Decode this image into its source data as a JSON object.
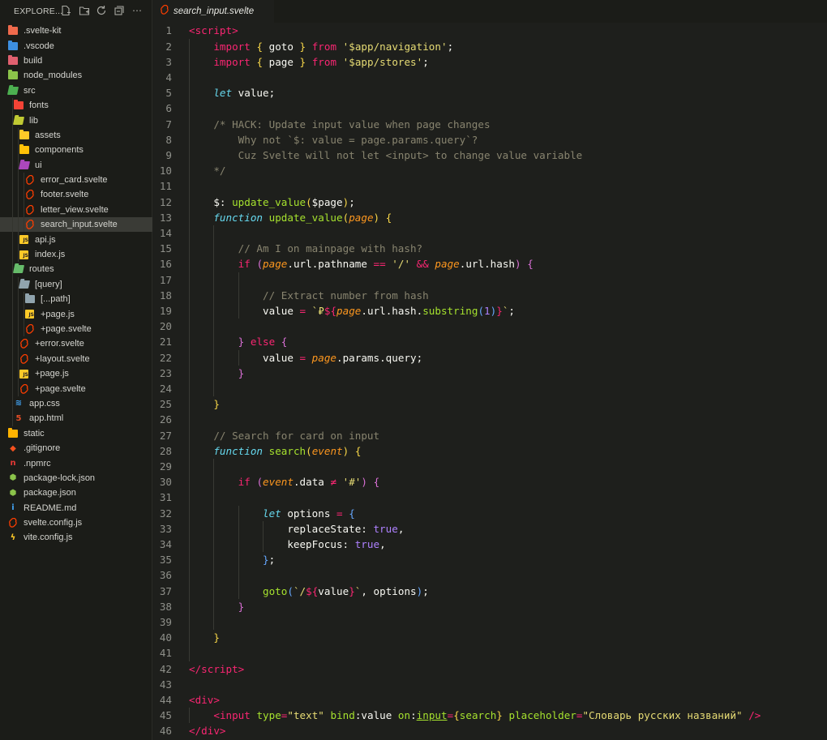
{
  "explorer": {
    "title": "EXPLORE...",
    "items": [
      {
        "label": ".svelte-kit",
        "depth": 0,
        "kind": "folder",
        "color": "#ef6a4c"
      },
      {
        "label": ".vscode",
        "depth": 0,
        "kind": "folder",
        "color": "#3d8fe0"
      },
      {
        "label": "build",
        "depth": 0,
        "kind": "folder",
        "color": "#e0606f"
      },
      {
        "label": "node_modules",
        "depth": 0,
        "kind": "folder",
        "color": "#8bc34a"
      },
      {
        "label": "src",
        "depth": 0,
        "kind": "folder-open",
        "color": "#4caf50"
      },
      {
        "label": "fonts",
        "depth": 1,
        "kind": "folder",
        "color": "#f44336"
      },
      {
        "label": "lib",
        "depth": 1,
        "kind": "folder-open",
        "color": "#c0ca33"
      },
      {
        "label": "assets",
        "depth": 2,
        "kind": "folder",
        "color": "#ffca28"
      },
      {
        "label": "components",
        "depth": 2,
        "kind": "folder",
        "color": "#ffc107"
      },
      {
        "label": "ui",
        "depth": 2,
        "kind": "folder-open",
        "color": "#ab47bc"
      },
      {
        "label": "error_card.svelte",
        "depth": 3,
        "kind": "svelte",
        "color": "#ff3e00"
      },
      {
        "label": "footer.svelte",
        "depth": 3,
        "kind": "svelte",
        "color": "#ff3e00"
      },
      {
        "label": "letter_view.svelte",
        "depth": 3,
        "kind": "svelte",
        "color": "#ff3e00"
      },
      {
        "label": "search_input.svelte",
        "depth": 3,
        "kind": "svelte",
        "color": "#ff3e00",
        "selected": true
      },
      {
        "label": "api.js",
        "depth": 2,
        "kind": "js",
        "color": "#ffca28"
      },
      {
        "label": "index.js",
        "depth": 2,
        "kind": "js",
        "color": "#ffca28"
      },
      {
        "label": "routes",
        "depth": 1,
        "kind": "folder-open",
        "color": "#66bb6a"
      },
      {
        "label": "[query]",
        "depth": 2,
        "kind": "folder-open",
        "color": "#90a4ae"
      },
      {
        "label": "[...path]",
        "depth": 3,
        "kind": "folder",
        "color": "#90a4ae"
      },
      {
        "label": "+page.js",
        "depth": 3,
        "kind": "js",
        "color": "#ffca28"
      },
      {
        "label": "+page.svelte",
        "depth": 3,
        "kind": "svelte",
        "color": "#ff3e00"
      },
      {
        "label": "+error.svelte",
        "depth": 2,
        "kind": "svelte",
        "color": "#ff3e00"
      },
      {
        "label": "+layout.svelte",
        "depth": 2,
        "kind": "svelte",
        "color": "#ff3e00"
      },
      {
        "label": "+page.js",
        "depth": 2,
        "kind": "js",
        "color": "#ffca28"
      },
      {
        "label": "+page.svelte",
        "depth": 2,
        "kind": "svelte",
        "color": "#ff3e00"
      },
      {
        "label": "app.css",
        "depth": 1,
        "kind": "css",
        "color": "#42a5f5"
      },
      {
        "label": "app.html",
        "depth": 1,
        "kind": "html",
        "color": "#e44d26"
      },
      {
        "label": "static",
        "depth": 0,
        "kind": "folder",
        "color": "#ffb300"
      },
      {
        "label": ".gitignore",
        "depth": 0,
        "kind": "git",
        "color": "#f4511e"
      },
      {
        "label": ".npmrc",
        "depth": 0,
        "kind": "npm",
        "color": "#e53935"
      },
      {
        "label": "package-lock.json",
        "depth": 0,
        "kind": "node",
        "color": "#8bc34a"
      },
      {
        "label": "package.json",
        "depth": 0,
        "kind": "node",
        "color": "#8bc34a"
      },
      {
        "label": "README.md",
        "depth": 0,
        "kind": "info",
        "color": "#42a5f5"
      },
      {
        "label": "svelte.config.js",
        "depth": 0,
        "kind": "svelte",
        "color": "#ff3e00"
      },
      {
        "label": "vite.config.js",
        "depth": 0,
        "kind": "vite",
        "color": "#ffca28"
      }
    ]
  },
  "tab": {
    "label": "search_input.svelte",
    "icon": "svelte-icon"
  },
  "editor": {
    "lines": [
      [
        [
          "t-tag",
          "<"
        ],
        [
          "t-tag",
          "script"
        ],
        [
          "t-tag",
          ">"
        ]
      ],
      [
        [
          "",
          "    "
        ],
        [
          "t-kw",
          "import"
        ],
        [
          "",
          " "
        ],
        [
          "t-br1",
          "{"
        ],
        [
          "",
          " goto "
        ],
        [
          "t-br1",
          "}"
        ],
        [
          "",
          " "
        ],
        [
          "t-kw",
          "from"
        ],
        [
          "",
          " "
        ],
        [
          "t-str",
          "'$app/navigation'"
        ],
        [
          "",
          ";"
        ]
      ],
      [
        [
          "",
          "    "
        ],
        [
          "t-kw",
          "import"
        ],
        [
          "",
          " "
        ],
        [
          "t-br1",
          "{"
        ],
        [
          "",
          " page "
        ],
        [
          "t-br1",
          "}"
        ],
        [
          "",
          " "
        ],
        [
          "t-kw",
          "from"
        ],
        [
          "",
          " "
        ],
        [
          "t-str",
          "'$app/stores'"
        ],
        [
          "",
          ";"
        ]
      ],
      [],
      [
        [
          "",
          "    "
        ],
        [
          "t-sto",
          "let"
        ],
        [
          "",
          " value;"
        ]
      ],
      [],
      [
        [
          "",
          "    "
        ],
        [
          "t-cm",
          "/* HACK: Update input value when page changes"
        ]
      ],
      [
        [
          "t-cm",
          "        Why not `$: value = page.params.query`?"
        ]
      ],
      [
        [
          "t-cm",
          "        Cuz Svelte will not let <input> to change value variable"
        ]
      ],
      [
        [
          "t-cm",
          "    */"
        ]
      ],
      [],
      [
        [
          "",
          "    $: "
        ],
        [
          "t-fn",
          "update_value"
        ],
        [
          "t-br1",
          "("
        ],
        [
          "",
          "$page"
        ],
        [
          "t-br1",
          ")"
        ],
        [
          "",
          ";"
        ]
      ],
      [
        [
          "",
          "    "
        ],
        [
          "t-sto",
          "function"
        ],
        [
          "",
          " "
        ],
        [
          "t-fn",
          "update_value"
        ],
        [
          "t-br1",
          "("
        ],
        [
          "t-par",
          "page"
        ],
        [
          "t-br1",
          ")"
        ],
        [
          "",
          " "
        ],
        [
          "t-br1",
          "{"
        ]
      ],
      [],
      [
        [
          "",
          "        "
        ],
        [
          "t-cm",
          "// Am I on mainpage with hash?"
        ]
      ],
      [
        [
          "",
          "        "
        ],
        [
          "t-kw",
          "if"
        ],
        [
          "",
          " "
        ],
        [
          "t-br2",
          "("
        ],
        [
          "t-par",
          "page"
        ],
        [
          "",
          ".url.pathname "
        ],
        [
          "t-kw",
          "=="
        ],
        [
          "",
          " "
        ],
        [
          "t-str",
          "'/'"
        ],
        [
          "",
          " "
        ],
        [
          "t-kw",
          "&&"
        ],
        [
          "",
          " "
        ],
        [
          "t-par",
          "page"
        ],
        [
          "",
          ".url.hash"
        ],
        [
          "t-br2",
          ")"
        ],
        [
          "",
          " "
        ],
        [
          "t-br2",
          "{"
        ]
      ],
      [],
      [
        [
          "",
          "            "
        ],
        [
          "t-cm",
          "// Extract number from hash"
        ]
      ],
      [
        [
          "",
          "            value "
        ],
        [
          "t-kw",
          "="
        ],
        [
          "",
          " "
        ],
        [
          "t-str",
          "`"
        ],
        [
          "t-str",
          "₽"
        ],
        [
          "t-kw",
          "${"
        ],
        [
          "t-par",
          "page"
        ],
        [
          "",
          ".url.hash."
        ],
        [
          "t-fn",
          "substring"
        ],
        [
          "t-br3",
          "("
        ],
        [
          "t-num",
          "1"
        ],
        [
          "t-br3",
          ")"
        ],
        [
          "t-kw",
          "}"
        ],
        [
          "t-str",
          "`"
        ],
        [
          "",
          ";"
        ]
      ],
      [],
      [
        [
          "",
          "        "
        ],
        [
          "t-br2",
          "}"
        ],
        [
          "",
          " "
        ],
        [
          "t-kw",
          "else"
        ],
        [
          "",
          " "
        ],
        [
          "t-br2",
          "{"
        ]
      ],
      [
        [
          "",
          "            value "
        ],
        [
          "t-kw",
          "="
        ],
        [
          "",
          " "
        ],
        [
          "t-par",
          "page"
        ],
        [
          "",
          ".params.query;"
        ]
      ],
      [
        [
          "",
          "        "
        ],
        [
          "t-br2",
          "}"
        ]
      ],
      [],
      [
        [
          "",
          "    "
        ],
        [
          "t-br1",
          "}"
        ]
      ],
      [],
      [
        [
          "",
          "    "
        ],
        [
          "t-cm",
          "// Search for card on input"
        ]
      ],
      [
        [
          "",
          "    "
        ],
        [
          "t-sto",
          "function"
        ],
        [
          "",
          " "
        ],
        [
          "t-fn",
          "search"
        ],
        [
          "t-br1",
          "("
        ],
        [
          "t-par",
          "event"
        ],
        [
          "t-br1",
          ")"
        ],
        [
          "",
          " "
        ],
        [
          "t-br1",
          "{"
        ]
      ],
      [],
      [
        [
          "",
          "        "
        ],
        [
          "t-kw",
          "if"
        ],
        [
          "",
          " "
        ],
        [
          "t-br2",
          "("
        ],
        [
          "t-par",
          "event"
        ],
        [
          "",
          ".data "
        ],
        [
          "t-kw",
          "≠"
        ],
        [
          "",
          " "
        ],
        [
          "t-str",
          "'#'"
        ],
        [
          "t-br2",
          ")"
        ],
        [
          "",
          " "
        ],
        [
          "t-br2",
          "{"
        ]
      ],
      [],
      [
        [
          "",
          "            "
        ],
        [
          "t-sto",
          "let"
        ],
        [
          "",
          " options "
        ],
        [
          "t-kw",
          "="
        ],
        [
          "",
          " "
        ],
        [
          "t-br3",
          "{"
        ]
      ],
      [
        [
          "",
          "                replaceState: "
        ],
        [
          "t-con",
          "true"
        ],
        [
          "",
          ","
        ]
      ],
      [
        [
          "",
          "                keepFocus: "
        ],
        [
          "t-con",
          "true"
        ],
        [
          "",
          ","
        ]
      ],
      [
        [
          "",
          "            "
        ],
        [
          "t-br3",
          "}"
        ],
        [
          "",
          ";"
        ]
      ],
      [],
      [
        [
          "",
          "            "
        ],
        [
          "t-fn",
          "goto"
        ],
        [
          "t-br3",
          "("
        ],
        [
          "t-str",
          "`/"
        ],
        [
          "t-kw",
          "${"
        ],
        [
          "",
          "value"
        ],
        [
          "t-kw",
          "}"
        ],
        [
          "t-str",
          "`"
        ],
        [
          "",
          ", options"
        ],
        [
          "t-br3",
          ")"
        ],
        [
          "",
          ";"
        ]
      ],
      [
        [
          "",
          "        "
        ],
        [
          "t-br2",
          "}"
        ]
      ],
      [],
      [
        [
          "",
          "    "
        ],
        [
          "t-br1",
          "}"
        ]
      ],
      [],
      [
        [
          "t-tag",
          "</"
        ],
        [
          "t-tag",
          "script"
        ],
        [
          "t-tag",
          ">"
        ]
      ],
      [],
      [
        [
          "t-tag",
          "<"
        ],
        [
          "t-tag",
          "div"
        ],
        [
          "t-tag",
          ">"
        ]
      ],
      [
        [
          "",
          "    "
        ],
        [
          "t-tag",
          "<"
        ],
        [
          "t-tag",
          "input"
        ],
        [
          "",
          " "
        ],
        [
          "t-at",
          "type"
        ],
        [
          "t-kw",
          "="
        ],
        [
          "t-str",
          "\"text\""
        ],
        [
          "",
          " "
        ],
        [
          "t-at",
          "bind"
        ],
        [
          "",
          ":value "
        ],
        [
          "t-at",
          "on"
        ],
        [
          "",
          ":"
        ],
        [
          "t-fn t-ul",
          "input"
        ],
        [
          "t-kw",
          "="
        ],
        [
          "t-br1",
          "{"
        ],
        [
          "t-fn",
          "search"
        ],
        [
          "t-br1",
          "}"
        ],
        [
          "",
          " "
        ],
        [
          "t-at",
          "placeholder"
        ],
        [
          "t-kw",
          "="
        ],
        [
          "t-str",
          "\"Словарь русских названий\""
        ],
        [
          "",
          " "
        ],
        [
          "t-tag",
          "/>"
        ]
      ],
      [
        [
          "t-tag",
          "</"
        ],
        [
          "t-tag",
          "div"
        ],
        [
          "t-tag",
          ">"
        ]
      ]
    ]
  }
}
